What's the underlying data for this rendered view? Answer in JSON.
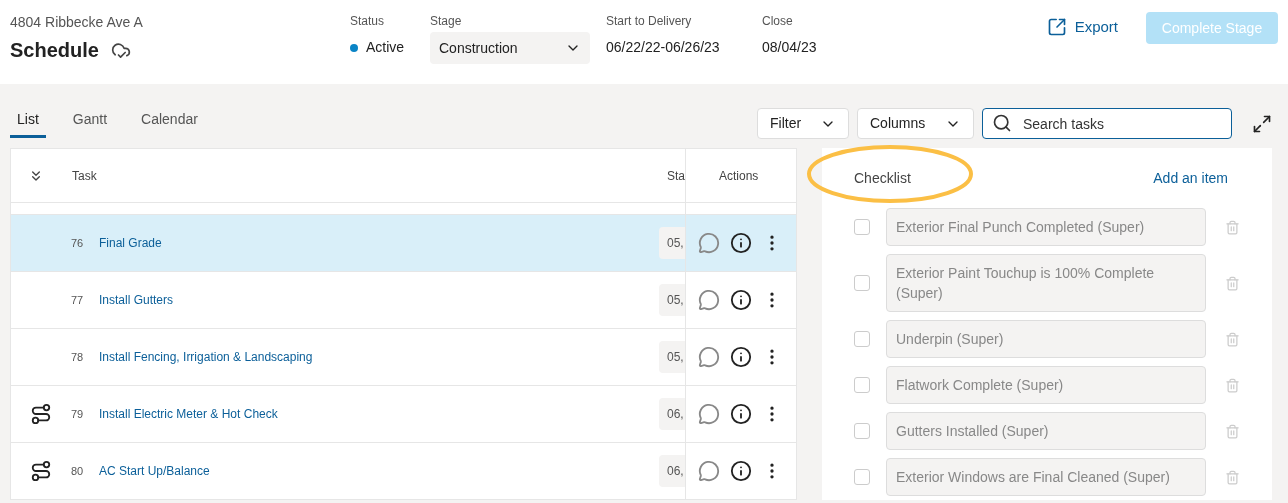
{
  "header": {
    "address": "4804 Ribbecke Ave A",
    "title": "Schedule",
    "status": {
      "label": "Status",
      "value": "Active",
      "color": "#0a84c6"
    },
    "stage": {
      "label": "Stage",
      "value": "Construction"
    },
    "delivery": {
      "label": "Start to Delivery",
      "value": "06/22/22-06/26/23"
    },
    "close": {
      "label": "Close",
      "value": "08/04/23"
    },
    "export": "Export",
    "complete": {
      "label": "Complete Stage",
      "disabled": true
    }
  },
  "tabs": [
    {
      "label": "List",
      "selected": true
    },
    {
      "label": "Gantt",
      "selected": false
    },
    {
      "label": "Calendar",
      "selected": false
    }
  ],
  "toolbar": {
    "filter": "Filter",
    "columns": "Columns",
    "search": {
      "placeholder": "Search tasks"
    }
  },
  "table": {
    "columns": [
      "Task",
      "Sta",
      "Actions"
    ],
    "rows": [
      {
        "number": "76",
        "task": "Final Grade",
        "date": "05,",
        "route": false,
        "selected": true
      },
      {
        "number": "77",
        "task": "Install Gutters",
        "date": "05,",
        "route": false,
        "selected": false
      },
      {
        "number": "78",
        "task": "Install Fencing, Irrigation & Landscaping",
        "date": "05,",
        "route": false,
        "selected": false
      },
      {
        "number": "79",
        "task": "Install Electric Meter & Hot Check",
        "date": "06,",
        "route": true,
        "selected": false
      },
      {
        "number": "80",
        "task": "AC Start Up/Balance",
        "date": "06,",
        "route": true,
        "selected": false
      }
    ]
  },
  "checklist": {
    "title": "Checklist",
    "highlighted": true,
    "add": "Add an item",
    "items": [
      {
        "text": "Exterior Final Punch Completed (Super)",
        "checked": false
      },
      {
        "text": "Exterior Paint Touchup is 100% Complete (Super)",
        "checked": false
      },
      {
        "text": "Underpin (Super)",
        "checked": false
      },
      {
        "text": "Flatwork Complete (Super)",
        "checked": false
      },
      {
        "text": "Gutters Installed (Super)",
        "checked": false
      },
      {
        "text": "Exterior Windows are Final Cleaned (Super)",
        "checked": false
      }
    ]
  }
}
